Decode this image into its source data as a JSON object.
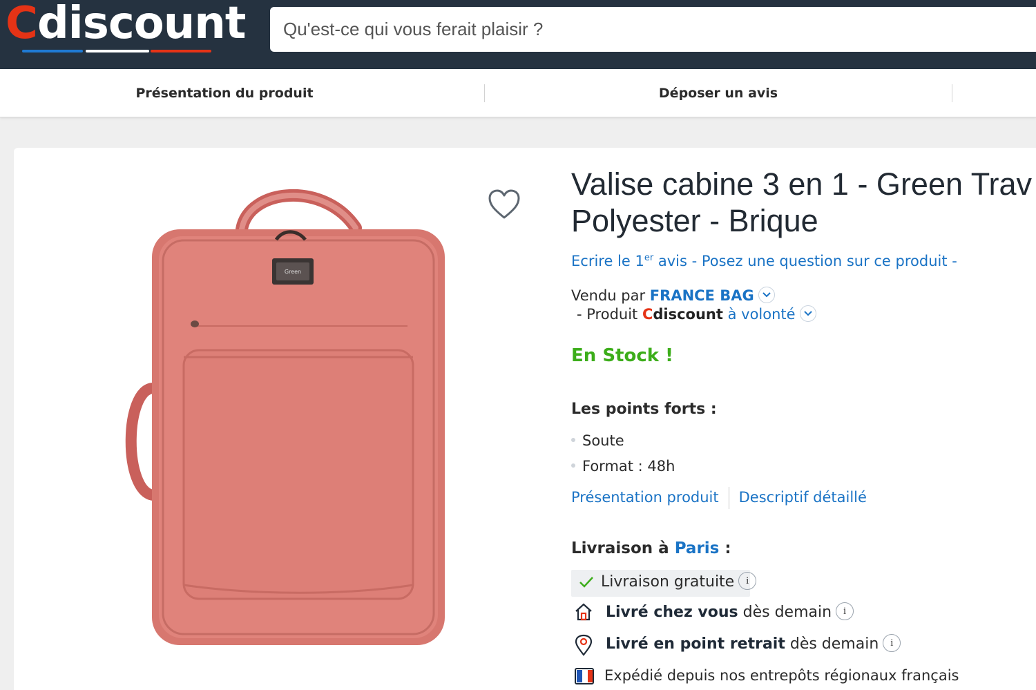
{
  "header": {
    "logo_first": "C",
    "logo_rest": "discount",
    "search_placeholder": "Qu'est-ce qui vous ferait plaisir ?"
  },
  "subnav": {
    "items": [
      "Présentation du produit",
      "Déposer un avis"
    ]
  },
  "product": {
    "title_line1": "Valise cabine 3 en 1 - Green Trav",
    "title_line2": "Polyester - Brique",
    "review_prefix": "Ecrire le 1",
    "review_sup": "er",
    "review_suffix": " avis",
    "review_sep1": " - ",
    "question_link": "Posez une question sur ce produit",
    "review_sep2": " -",
    "sold_by_label": "Vendu par ",
    "seller_name": "FRANCE BAG",
    "product_prefix": "- Produit ",
    "cd_c": "C",
    "cd_rest": "discount",
    "cd_volonte": " à volonté",
    "stock": "En Stock !"
  },
  "highlights": {
    "title": "Les points forts :",
    "items": [
      "Soute",
      "Format : 48h"
    ],
    "link_presentation": "Présentation produit",
    "link_descriptif": "Descriptif détaillé"
  },
  "delivery": {
    "title_prefix": "Livraison à ",
    "city": "Paris",
    "title_suffix": " :",
    "free": "Livraison gratuite",
    "home_bold": "Livré chez vous",
    "home_rest": " dès demain",
    "relay_bold": "Livré en point retrait",
    "relay_rest": " dès demain",
    "shipped": "Expédié depuis nos entrepôts régionaux français",
    "info_glyph": "i"
  },
  "colors": {
    "header_bg": "#253240",
    "brand_red": "#e53316",
    "link_blue": "#1a73c5",
    "stock_green": "#3cad1a",
    "product_color": "#dd7f7a"
  },
  "icons": [
    "heart-icon",
    "check-icon",
    "home-icon",
    "location-pin-icon",
    "french-flag-icon",
    "chevron-down-icon",
    "info-icon"
  ]
}
